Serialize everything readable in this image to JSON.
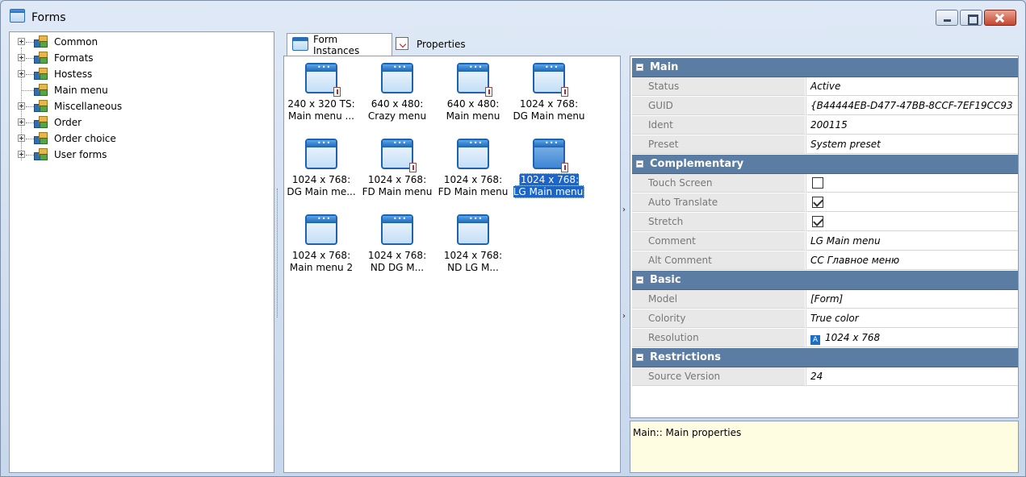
{
  "window": {
    "title": "Forms",
    "buttons": [
      "minimize",
      "maximize",
      "close"
    ]
  },
  "tree": {
    "items": [
      {
        "label": "Common",
        "expandable": true
      },
      {
        "label": "Formats",
        "expandable": true
      },
      {
        "label": "Hostess",
        "expandable": true
      },
      {
        "label": "Main menu",
        "expandable": false
      },
      {
        "label": "Miscellaneous",
        "expandable": true
      },
      {
        "label": "Order",
        "expandable": true
      },
      {
        "label": "Order choice",
        "expandable": true
      },
      {
        "label": "User forms",
        "expandable": true
      }
    ]
  },
  "tabs": [
    {
      "label": "Form Instances",
      "active": true
    },
    {
      "label": "Properties",
      "active": false
    }
  ],
  "instances": [
    {
      "line1": "240 x 320 TS:",
      "line2": "Main menu ...",
      "warning": true
    },
    {
      "line1": "640 x 480:",
      "line2": "Crazy menu",
      "warning": false
    },
    {
      "line1": "640 x 480:",
      "line2": "Main menu",
      "warning": true
    },
    {
      "line1": "1024 x 768:",
      "line2": "DG Main menu",
      "warning": true
    },
    {
      "line1": "1024 x 768:",
      "line2": "DG Main me...",
      "warning": false
    },
    {
      "line1": "1024 x 768:",
      "line2": "FD Main menu",
      "warning": true
    },
    {
      "line1": "1024 x 768:",
      "line2": "FD Main menu",
      "warning": false
    },
    {
      "line1": "1024 x 768:",
      "line2": "LG Main menu",
      "warning": true,
      "selected": true
    },
    {
      "line1": "1024 x 768:",
      "line2": "Main menu 2",
      "warning": false
    },
    {
      "line1": "1024 x 768:",
      "line2": "ND DG M...",
      "warning": false
    },
    {
      "line1": "1024 x 768:",
      "line2": "ND LG M...",
      "warning": false
    }
  ],
  "properties": {
    "main": {
      "title": "Main",
      "status": {
        "name": "Status",
        "value": "Active"
      },
      "guid": {
        "name": "GUID",
        "value": "{B44444EB-D477-47BB-8CCF-7EF19CC93"
      },
      "ident": {
        "name": "Ident",
        "value": "200115"
      },
      "preset": {
        "name": "Preset",
        "value": "System preset"
      }
    },
    "complementary": {
      "title": "Complementary",
      "touch_screen": {
        "name": "Touch Screen",
        "checked": false
      },
      "auto_translate": {
        "name": "Auto Translate",
        "checked": true
      },
      "stretch": {
        "name": "Stretch",
        "checked": true
      },
      "comment": {
        "name": "Comment",
        "value": "LG Main menu"
      },
      "alt_comment": {
        "name": "Alt Comment",
        "value": "СС Главное меню"
      }
    },
    "basic": {
      "title": "Basic",
      "model": {
        "name": "Model",
        "value": "[Form]"
      },
      "colority": {
        "name": "Colority",
        "value": "True color"
      },
      "resolution": {
        "name": "Resolution",
        "value": "1024 x 768",
        "icon_letter": "A"
      }
    },
    "restrictions": {
      "title": "Restrictions",
      "source_version": {
        "name": "Source Version",
        "value": "24"
      }
    }
  },
  "description": "Main:: Main properties"
}
